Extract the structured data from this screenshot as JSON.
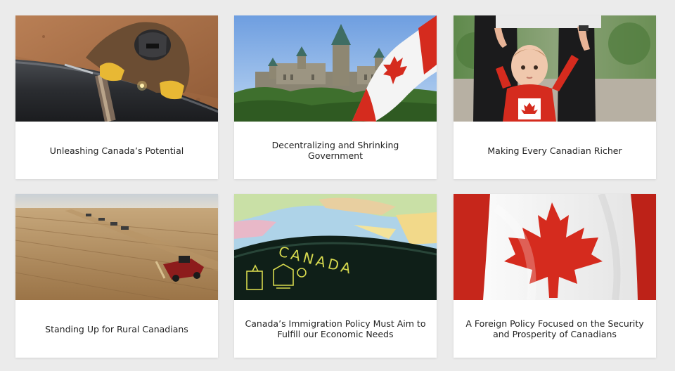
{
  "cards": [
    {
      "title": "Unleashing Canada’s Potential",
      "image": "welder-on-pipeline"
    },
    {
      "title": "Decentralizing and Shrinking Government",
      "image": "parliament-hill-with-canadian-flag"
    },
    {
      "title": "Making Every Canadian Richer",
      "image": "toddler-in-canada-shirt"
    },
    {
      "title": "Standing Up for Rural Canadians",
      "image": "combine-harvesters-in-field"
    },
    {
      "title": "Canada’s Immigration Policy Must Aim to Fulfill our Economic Needs",
      "image": "canadian-passport-on-map",
      "passport_text": "CANADA"
    },
    {
      "title": "A Foreign Policy Focused on the Security and Prosperity of Canadians",
      "image": "canadian-flag-closeup"
    }
  ],
  "colors": {
    "background": "#ebebeb",
    "card": "#ffffff",
    "text": "#222222",
    "flag_red": "#d52b1e"
  }
}
